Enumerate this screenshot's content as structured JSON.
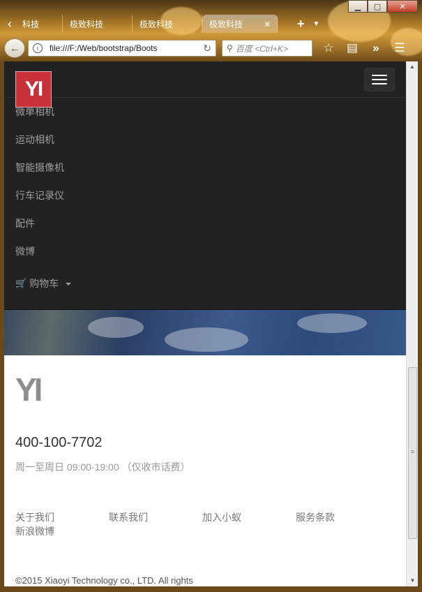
{
  "browser": {
    "tabs": [
      {
        "label": "科技"
      },
      {
        "label": "极致科技"
      },
      {
        "label": "极致科技"
      },
      {
        "label": "极致科技"
      }
    ],
    "tab_close": "×",
    "new_tab": "+",
    "url": "file:///F:/Web/bootstrap/Boots",
    "search_placeholder": "百度 <Ctrl+K>"
  },
  "site_nav": {
    "logo_text": "YI",
    "menu_items": [
      {
        "label": "微单相机"
      },
      {
        "label": "运动相机"
      },
      {
        "label": "智能摄像机"
      },
      {
        "label": "行车记录仪"
      },
      {
        "label": "配件"
      },
      {
        "label": "微博"
      }
    ],
    "cart_label": "购物车"
  },
  "footer": {
    "logo_text": "YI",
    "phone": "400-100-7702",
    "hours": "周一至周日 09:00-19:00 （仅收市话费）",
    "links": [
      {
        "label": "关于我们"
      },
      {
        "label": "联系我们"
      },
      {
        "label": "加入小蚁"
      },
      {
        "label": "服务条款"
      },
      {
        "label": "新浪微博"
      }
    ],
    "copyright": "©2015 Xiaoyi Technology co., LTD. All rights"
  },
  "colors": {
    "nav_bg": "#222222",
    "nav_link": "#9d9d9d",
    "logo_red": "#c8303a",
    "footer_logo": "#8e8e8e"
  }
}
